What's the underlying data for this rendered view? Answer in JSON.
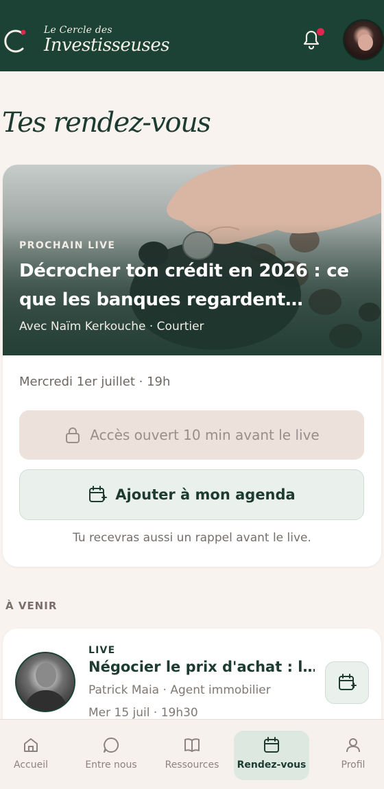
{
  "header": {
    "logo_line1": "Le Cercle des",
    "logo_line2": "Investisseuses",
    "notification_dot_color": "#e0264d"
  },
  "page": {
    "title": "Tes rendez-vous"
  },
  "featured": {
    "eyebrow": "PROCHAIN LIVE",
    "title": "Décrocher ton crédit en 2026 : ce que les banques regardent…",
    "subtitle": "Avec Naïm Kerkouche · Courtier",
    "date": "Mercredi 1er juillet · 19h",
    "locked_button": "Accès ouvert 10 min avant le live",
    "agenda_button": "Ajouter à mon agenda",
    "reminder": "Tu recevras aussi un rappel avant le live."
  },
  "upcoming": {
    "section_label": "À VENIR",
    "items": [
      {
        "tag": "LIVE",
        "title": "Négocier le prix d'achat : l…",
        "subtitle": "Patrick Maia · Agent immobilier",
        "date": "Mer 15 juil · 19h30"
      }
    ]
  },
  "nav": {
    "items": [
      {
        "label": "Accueil",
        "icon": "home-icon",
        "active": false
      },
      {
        "label": "Entre nous",
        "icon": "chat-icon",
        "active": false
      },
      {
        "label": "Ressources",
        "icon": "book-icon",
        "active": false
      },
      {
        "label": "Rendez-vous",
        "icon": "calendar-icon",
        "active": true
      },
      {
        "label": "Profil",
        "icon": "user-icon",
        "active": false
      }
    ]
  },
  "colors": {
    "brand_green": "#1b4234",
    "background": "#f8f3ef",
    "accent_red": "#e0264d"
  }
}
